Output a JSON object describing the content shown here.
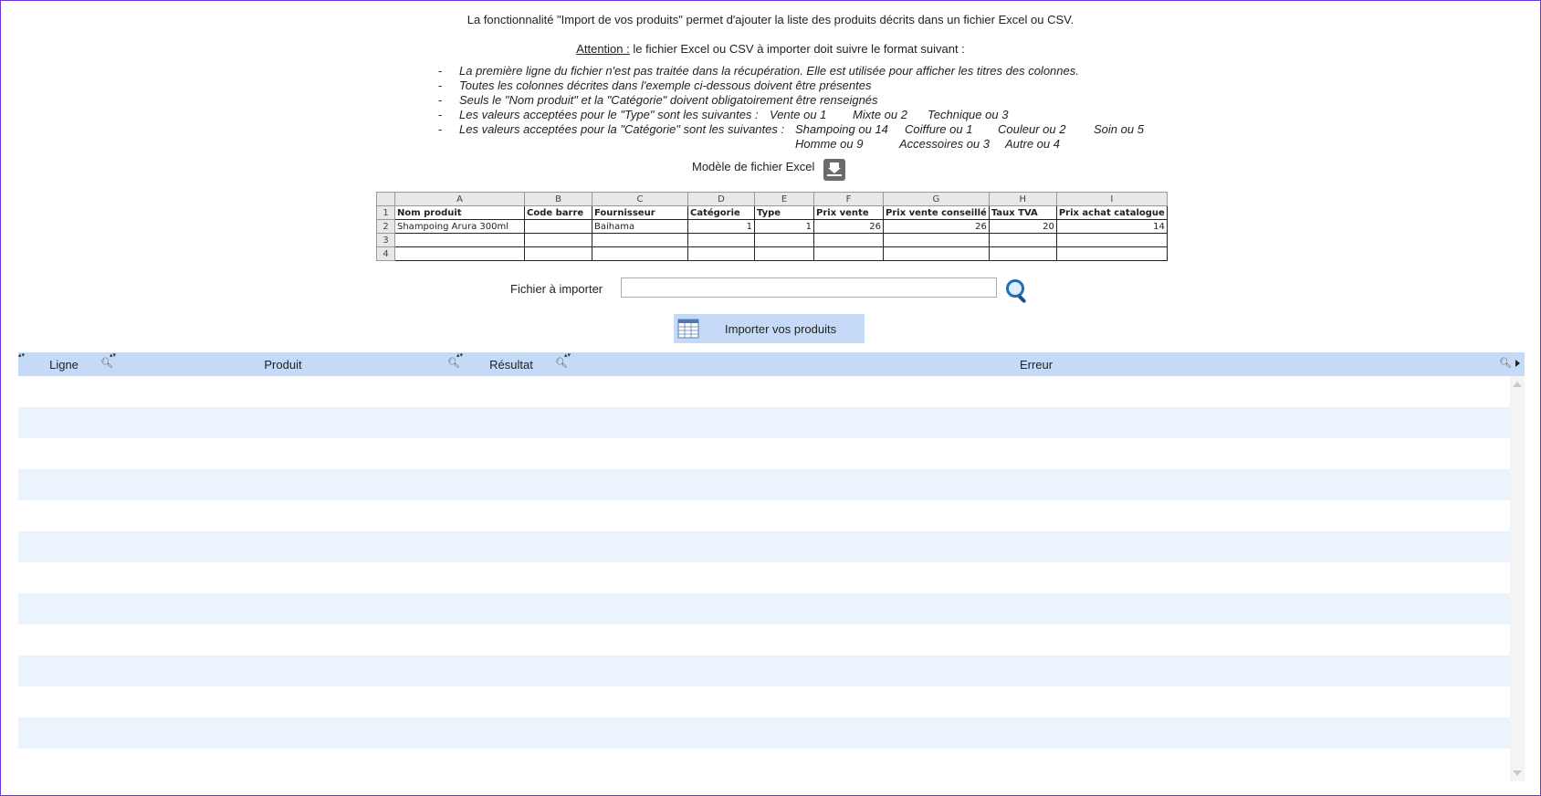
{
  "intro": "La fonctionnalité \"Import de vos produits\" permet d'ajouter la liste des produits décrits dans un fichier Excel ou CSV.",
  "attention": {
    "label": "Attention :",
    "text": " le fichier Excel ou CSV à importer doit suivre le format suivant :"
  },
  "rules": {
    "dash": "-",
    "r1": "La première ligne du fichier n'est pas traitée dans la récupération. Elle est utilisée pour afficher les titres des colonnes.",
    "r2": "Toutes les colonnes décrites dans l'exemple ci-dessous doivent être présentes",
    "r3": "Seuls le \"Nom produit\" et la \"Catégorie\" doivent obligatoirement être renseignés",
    "r4": "Les valeurs acceptées pour le \"Type\" sont les suivantes :",
    "types": [
      "Vente ou 1",
      "Mixte ou 2",
      "Technique ou 3"
    ],
    "r5": "Les valeurs acceptées pour la \"Catégorie\" sont les suivantes :",
    "categories_line1": [
      "Shampoing ou 14",
      "Coiffure ou 1",
      "Couleur ou 2",
      "Soin ou 5"
    ],
    "categories_line2": [
      "Homme ou 9",
      "Accessoires ou 3",
      "Autre ou 4"
    ]
  },
  "model": {
    "label": "Modèle de fichier Excel",
    "icon": "download-icon"
  },
  "excel": {
    "col_letters": [
      "A",
      "B",
      "C",
      "D",
      "E",
      "F",
      "G",
      "H",
      "I"
    ],
    "row_numbers": [
      "1",
      "2",
      "3",
      "4"
    ],
    "titles": [
      "Nom produit",
      "Code barre",
      "Fournisseur",
      "Catégorie",
      "Type",
      "Prix vente",
      "Prix vente conseillé",
      "Taux TVA",
      "Prix achat catalogue"
    ],
    "example": [
      "Shampoing Arura 300ml",
      "",
      "Baihama",
      "1",
      "1",
      "26",
      "26",
      "20",
      "14"
    ]
  },
  "file": {
    "label": "Fichier à importer",
    "value": "",
    "icon": "search-icon"
  },
  "import_button": {
    "label": "Importer vos produits",
    "icon": "table-icon"
  },
  "grid": {
    "columns": [
      "Ligne",
      "Produit",
      "Résultat",
      "Erreur"
    ],
    "colors": {
      "header": "#c4daf7",
      "alt_row": "#ebf4fd"
    }
  }
}
